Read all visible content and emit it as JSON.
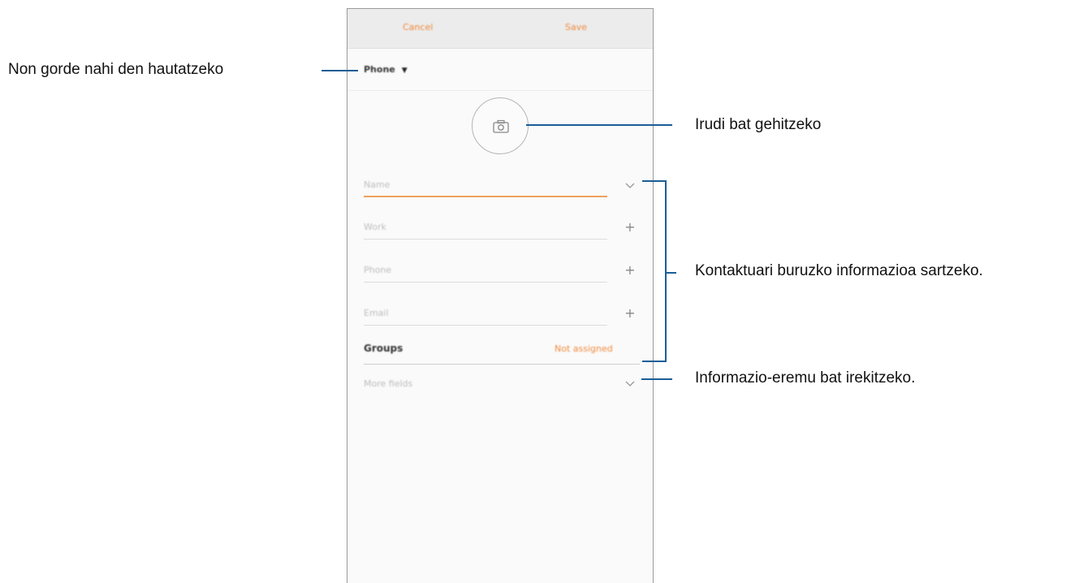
{
  "phone": {
    "topbar": {
      "cancel_label": "Cancel",
      "save_label": "Save"
    },
    "storage_selector": {
      "label": "Phone"
    },
    "fields": [
      {
        "placeholder": "Name",
        "trailing_icon": "chevron-down-icon"
      },
      {
        "placeholder": "Work",
        "trailing_icon": "plus-icon"
      },
      {
        "placeholder": "Phone",
        "trailing_icon": "plus-icon"
      },
      {
        "placeholder": "Email",
        "trailing_icon": "plus-icon"
      }
    ],
    "groups": {
      "label": "Groups",
      "value": "Not assigned"
    },
    "more_fields": {
      "label": "More fields"
    },
    "accent_color": "#f08a3c"
  },
  "annotations": {
    "storage": "Non gorde nahi den hautatzeko",
    "image": "Irudi bat gehitzeko",
    "contact_info": "Kontaktuari buruzko informazioa sartzeko.",
    "more_fields": "Informazio-eremu bat irekitzeko."
  }
}
